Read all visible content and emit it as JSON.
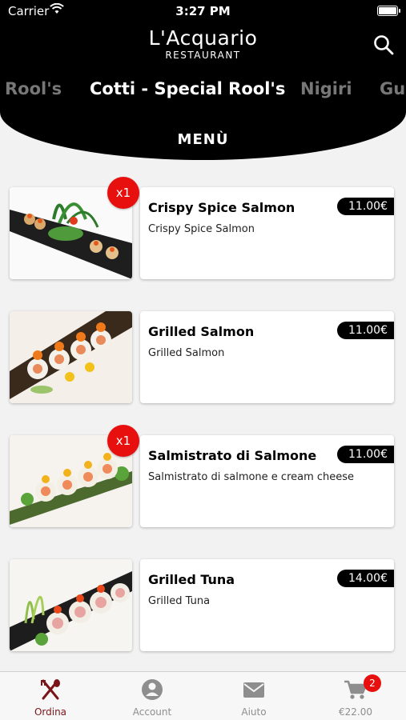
{
  "status": {
    "carrier": "Carrier",
    "time": "3:27 PM"
  },
  "brand": {
    "name": "L'Acquario",
    "subtitle": "RESTAURANT"
  },
  "categories": [
    "Rool's",
    "Cotti - Special Rool's",
    "Nigiri",
    "Gu"
  ],
  "menu_title": "MENÙ",
  "items": [
    {
      "name": "Crispy Spice Salmon",
      "description": "Crispy Spice Salmon",
      "price": "11.00€",
      "badge": "x1"
    },
    {
      "name": "Grilled Salmon",
      "description": "Grilled Salmon",
      "price": "11.00€",
      "badge": ""
    },
    {
      "name": "Salmistrato di Salmone",
      "description": "Salmistrato di salmone e cream cheese",
      "price": "11.00€",
      "badge": "x1"
    },
    {
      "name": "Grilled Tuna",
      "description": "Grilled Tuna",
      "price": "14.00€",
      "badge": ""
    }
  ],
  "tabs": [
    {
      "label": "Ordina"
    },
    {
      "label": "Account"
    },
    {
      "label": "Aiuto"
    },
    {
      "label": "€22.00",
      "badge": "2"
    }
  ],
  "colors": {
    "header": "#000000",
    "accent": "#7a1419",
    "badge": "#e8100f"
  }
}
